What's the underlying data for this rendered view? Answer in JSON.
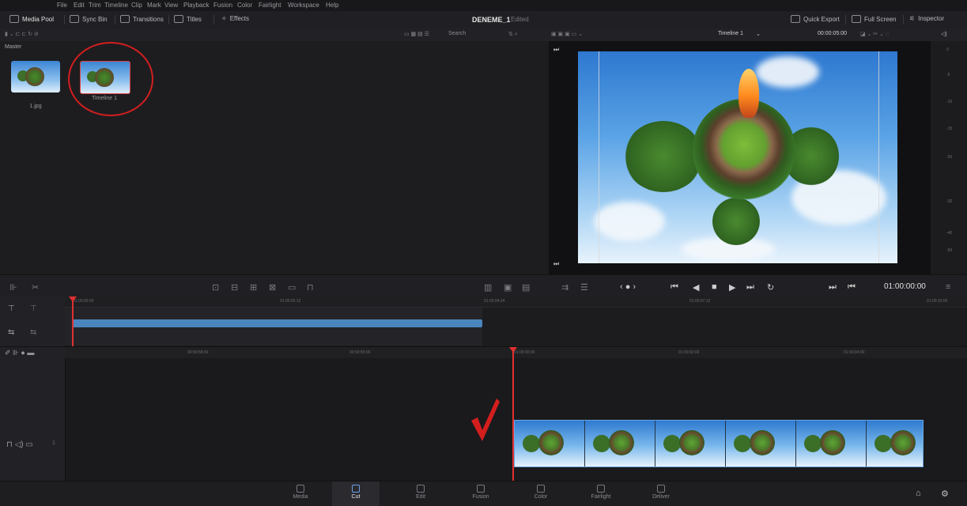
{
  "menu": [
    "File",
    "Edit",
    "Trim",
    "Timeline",
    "Clip",
    "Mark",
    "View",
    "Playback",
    "Fusion",
    "Color",
    "Fairlight",
    "Workspace",
    "Help"
  ],
  "toolbar": {
    "media_pool": "Media Pool",
    "sync_bin": "Sync Bin",
    "transitions": "Transitions",
    "titles": "Titles",
    "effects": "Effects",
    "project": "DENEME_1",
    "status": "Edited",
    "quick_export": "Quick Export",
    "full_screen": "Full Screen",
    "inspector": "Inspector"
  },
  "subbar": {
    "search": "Search",
    "timeline_name": "Timeline 1",
    "duration": "00:00:05:00"
  },
  "pool": {
    "bin": "Master",
    "clips": [
      "1.jpg",
      "Timeline 1"
    ]
  },
  "meter_labels": [
    "0",
    "-5",
    "-10",
    "-15",
    "-20",
    "-30",
    "-40",
    "-50"
  ],
  "viewer": {
    "timecode": "01:00:00:00"
  },
  "upper_ruler": [
    "01:00:00:00",
    "01:00:02:12",
    "01:00:04:24",
    "01:00:07:12",
    "01:00:10:00"
  ],
  "lower_ruler": [
    "00:59:58:00",
    "00:59:59:00",
    "01:00:00:00",
    "01:00:02:00",
    "01:00:04:00"
  ],
  "tabs": [
    {
      "label": "Media",
      "icon": "media-icon"
    },
    {
      "label": "Cut",
      "icon": "cut-icon",
      "active": true
    },
    {
      "label": "Edit",
      "icon": "edit-icon"
    },
    {
      "label": "Fusion",
      "icon": "fusion-icon"
    },
    {
      "label": "Color",
      "icon": "color-icon"
    },
    {
      "label": "Fairlight",
      "icon": "fairlight-icon"
    },
    {
      "label": "Deliver",
      "icon": "deliver-icon"
    }
  ],
  "colors": {
    "accent_red": "#e03030",
    "clip_blue": "#4a86bd",
    "tab_active": "#6ea0e8"
  }
}
